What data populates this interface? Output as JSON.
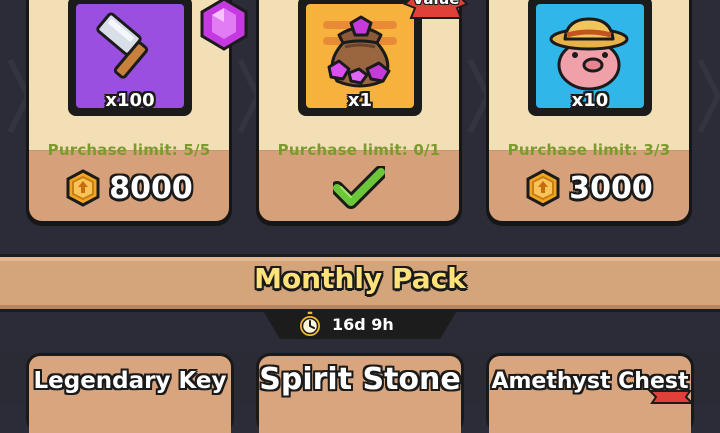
{
  "shop": {
    "items": [
      {
        "qty": "x100",
        "limit": "Purchase limit: 5/5",
        "price": "8000",
        "tile_color": "#9b4fe0",
        "icon": "hammer-icon",
        "currency_icon": "gold-medal-icon"
      },
      {
        "qty": "x1",
        "limit": "Purchase limit: 0/1",
        "status": "purchased",
        "tile_color": "#f6b23c",
        "icon": "gem-bag-icon",
        "status_icon": "check-icon"
      },
      {
        "qty": "x10",
        "limit": "Purchase limit: 3/3",
        "price": "3000",
        "tile_color": "#31b6ea",
        "icon": "pig-hat-icon",
        "currency_icon": "gold-medal-icon"
      }
    ],
    "value_badge": "Value",
    "colors": {
      "limit_text": "#7b9b2e",
      "card_cream": "#f3dfb5",
      "card_tan": "#d6a17a"
    }
  },
  "monthly_pack": {
    "title": "Monthly Pack",
    "timer": "16d 9h",
    "title_color": "#ffe27a"
  },
  "bottom_cards": [
    {
      "label": "Legendary Key"
    },
    {
      "label": "Spirit Stone"
    },
    {
      "label": "Amethyst Chest"
    }
  ]
}
